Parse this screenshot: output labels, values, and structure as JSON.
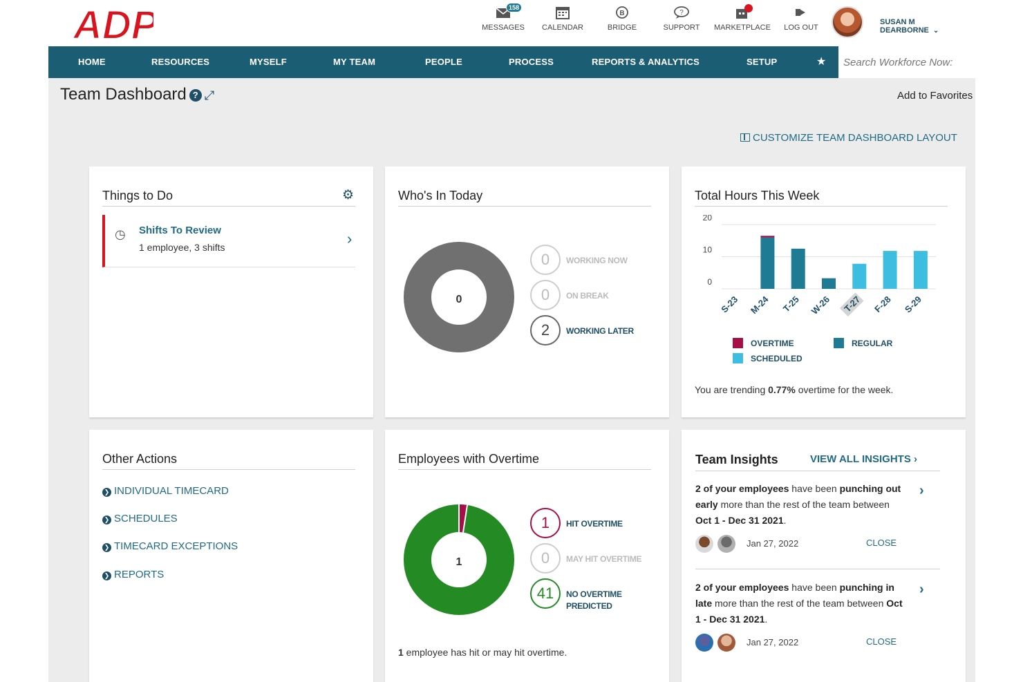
{
  "header": {
    "logo_text": "ADP",
    "icons": [
      {
        "icon": "messages-icon",
        "label": "MESSAGES",
        "badge": "158"
      },
      {
        "icon": "calendar-icon",
        "label": "CALENDAR"
      },
      {
        "icon": "bridge-icon",
        "label": "BRIDGE"
      },
      {
        "icon": "support-icon",
        "label": "SUPPORT"
      },
      {
        "icon": "marketplace-icon",
        "label": "MARKETPLACE"
      },
      {
        "icon": "logout-icon",
        "label": "LOG OUT"
      }
    ],
    "user_name": "SUSAN M DEARBORNE"
  },
  "nav": {
    "items": [
      "HOME",
      "RESOURCES",
      "MYSELF",
      "MY TEAM",
      "PEOPLE",
      "PROCESS",
      "REPORTS & ANALYTICS",
      "SETUP"
    ],
    "search_placeholder": "Search Workforce Now:"
  },
  "page": {
    "title": "Team Dashboard",
    "add_to_favorites": "Add to Favorites",
    "customize_label": "CUSTOMIZE TEAM DASHBOARD LAYOUT"
  },
  "things_to_do": {
    "title": "Things to Do",
    "tasks": [
      {
        "name": "Shifts To Review",
        "desc": "1 employee, 3 shifts"
      }
    ]
  },
  "whos_in": {
    "title": "Who's In Today",
    "donut_center": "0",
    "stats": [
      {
        "value": "0",
        "label": "WORKING NOW"
      },
      {
        "value": "0",
        "label": "ON BREAK"
      },
      {
        "value": "2",
        "label": "WORKING LATER"
      }
    ]
  },
  "total_hours": {
    "title": "Total Hours This Week",
    "trend_prefix": "You are trending ",
    "trend_value": "0.77%",
    "trend_suffix": " overtime for the week."
  },
  "chart_data": {
    "type": "bar",
    "title": "Total Hours This Week",
    "categories": [
      "S-23",
      "M-24",
      "T-25",
      "W-26",
      "T-27",
      "F-28",
      "S-29"
    ],
    "series": [
      {
        "name": "REGULAR",
        "values": [
          0,
          16,
          12.5,
          3.3,
          0,
          0,
          0
        ]
      },
      {
        "name": "OVERTIME",
        "values": [
          0,
          0.5,
          0,
          0,
          0,
          0,
          0
        ]
      },
      {
        "name": "SCHEDULED",
        "values": [
          0,
          0,
          0,
          0,
          7.8,
          11.8,
          11.8
        ]
      }
    ],
    "yticks": [
      "20",
      "10",
      "0"
    ],
    "ylim": [
      0,
      20
    ],
    "highlight_category": "T-27",
    "legend": [
      "OVERTIME",
      "REGULAR",
      "SCHEDULED"
    ],
    "colors": {
      "OVERTIME": "#a50f45",
      "REGULAR": "#1f7a93",
      "SCHEDULED": "#3dbde0"
    }
  },
  "other_actions": {
    "title": "Other Actions",
    "links": [
      "INDIVIDUAL TIMECARD",
      "SCHEDULES",
      "TIMECARD EXCEPTIONS",
      "REPORTS"
    ]
  },
  "overtime": {
    "title": "Employees with Overtime",
    "donut_center": "1",
    "stats": [
      {
        "value": "1",
        "label": "HIT OVERTIME"
      },
      {
        "value": "0",
        "label": "MAY HIT OVERTIME"
      },
      {
        "value": "41",
        "label": "NO OVERTIME PREDICTED"
      }
    ],
    "footer_count": "1",
    "footer_text": " employee has hit or may hit overtime.",
    "hit_fraction": 0.024
  },
  "insights": {
    "title": "Team Insights",
    "view_all": "VIEW ALL INSIGHTS",
    "items": [
      {
        "count_text": "2 of your employees",
        "t1": " have been ",
        "emph": "punching out early",
        "t2": " more than the rest of the team between ",
        "range": "Oct 1 - Dec 31 2021",
        "end": ".",
        "date": "Jan 27, 2022",
        "close": "CLOSE"
      },
      {
        "count_text": "2 of your employees",
        "t1": " have been ",
        "emph": "punching in late",
        "t2": " more than the rest of the team between ",
        "range": "Oct 1 - Dec 31 2021",
        "end": ".",
        "date": "Jan 27, 2022",
        "close": "CLOSE"
      }
    ]
  }
}
